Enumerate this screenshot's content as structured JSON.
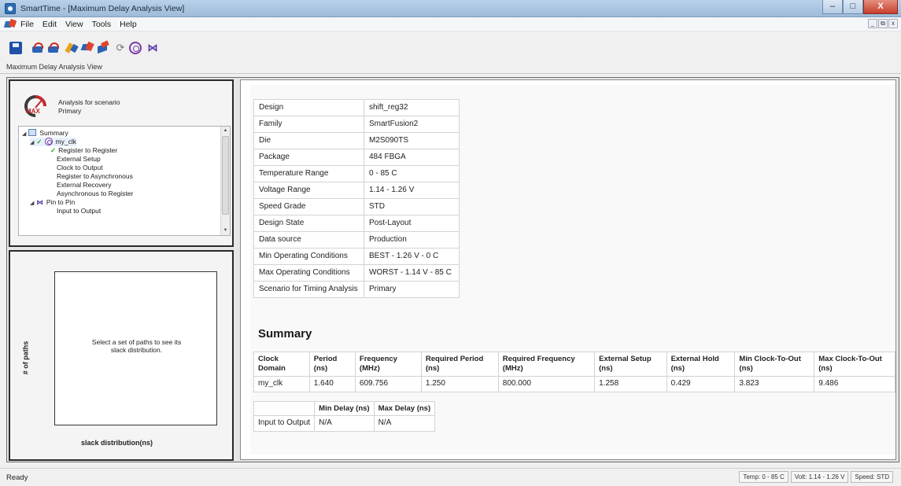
{
  "window": {
    "title": "SmartTime - [Maximum Delay Analysis View]",
    "buttons": {
      "minimize": "–",
      "maximize": "□",
      "close": "X"
    }
  },
  "menu": {
    "items": [
      "File",
      "Edit",
      "View",
      "Tools",
      "Help"
    ],
    "mdi_buttons": [
      "_",
      "⧉",
      "x"
    ]
  },
  "view_label": "Maximum Delay Analysis View",
  "scenario": {
    "gauge_label": "MAX",
    "line1": "Analysis for scenario",
    "line2": "Primary"
  },
  "tree": {
    "items": [
      {
        "label": "Summary"
      },
      {
        "label": "my_clk"
      },
      {
        "label": "Register to Register"
      },
      {
        "label": "External Setup"
      },
      {
        "label": "Clock to Output"
      },
      {
        "label": "Register to Asynchronous"
      },
      {
        "label": "External Recovery"
      },
      {
        "label": "Asynchronous to Register"
      },
      {
        "label": "Pin to Pin"
      },
      {
        "label": "Input to Output"
      }
    ]
  },
  "histogram": {
    "message": "Select a set of paths to see its slack distribution.",
    "y_label": "# of paths",
    "x_label": "slack distribution(ns)"
  },
  "properties": [
    {
      "key": "Design",
      "value": "shift_reg32"
    },
    {
      "key": "Family",
      "value": "SmartFusion2"
    },
    {
      "key": "Die",
      "value": "M2S090TS"
    },
    {
      "key": "Package",
      "value": "484 FBGA"
    },
    {
      "key": "Temperature Range",
      "value": "0 - 85 C"
    },
    {
      "key": "Voltage Range",
      "value": "1.14 - 1.26 V"
    },
    {
      "key": "Speed Grade",
      "value": "STD"
    },
    {
      "key": "Design State",
      "value": "Post-Layout"
    },
    {
      "key": "Data source",
      "value": "Production"
    },
    {
      "key": "Min Operating Conditions",
      "value": "BEST - 1.26 V - 0 C"
    },
    {
      "key": "Max Operating Conditions",
      "value": "WORST - 1.14 V - 85 C"
    },
    {
      "key": "Scenario for Timing Analysis",
      "value": "Primary"
    }
  ],
  "summary": {
    "heading": "Summary",
    "headers": [
      "Clock Domain",
      "Period (ns)",
      "Frequency (MHz)",
      "Required Period (ns)",
      "Required Frequency (MHz)",
      "External Setup (ns)",
      "External Hold (ns)",
      "Min Clock-To-Out (ns)",
      "Max Clock-To-Out (ns)"
    ],
    "rows": [
      [
        "my_clk",
        "1.640",
        "609.756",
        "1.250",
        "800.000",
        "1.258",
        "0.429",
        "3.823",
        "9.486"
      ]
    ]
  },
  "io_table": {
    "headers": [
      "",
      "Min Delay (ns)",
      "Max Delay (ns)"
    ],
    "rows": [
      [
        "Input to Output",
        "N/A",
        "N/A"
      ]
    ]
  },
  "status": {
    "ready": "Ready",
    "temp": "Temp: 0 - 85 C",
    "volt": "Volt: 1.14 - 1.26 V",
    "speed": "Speed: STD"
  }
}
